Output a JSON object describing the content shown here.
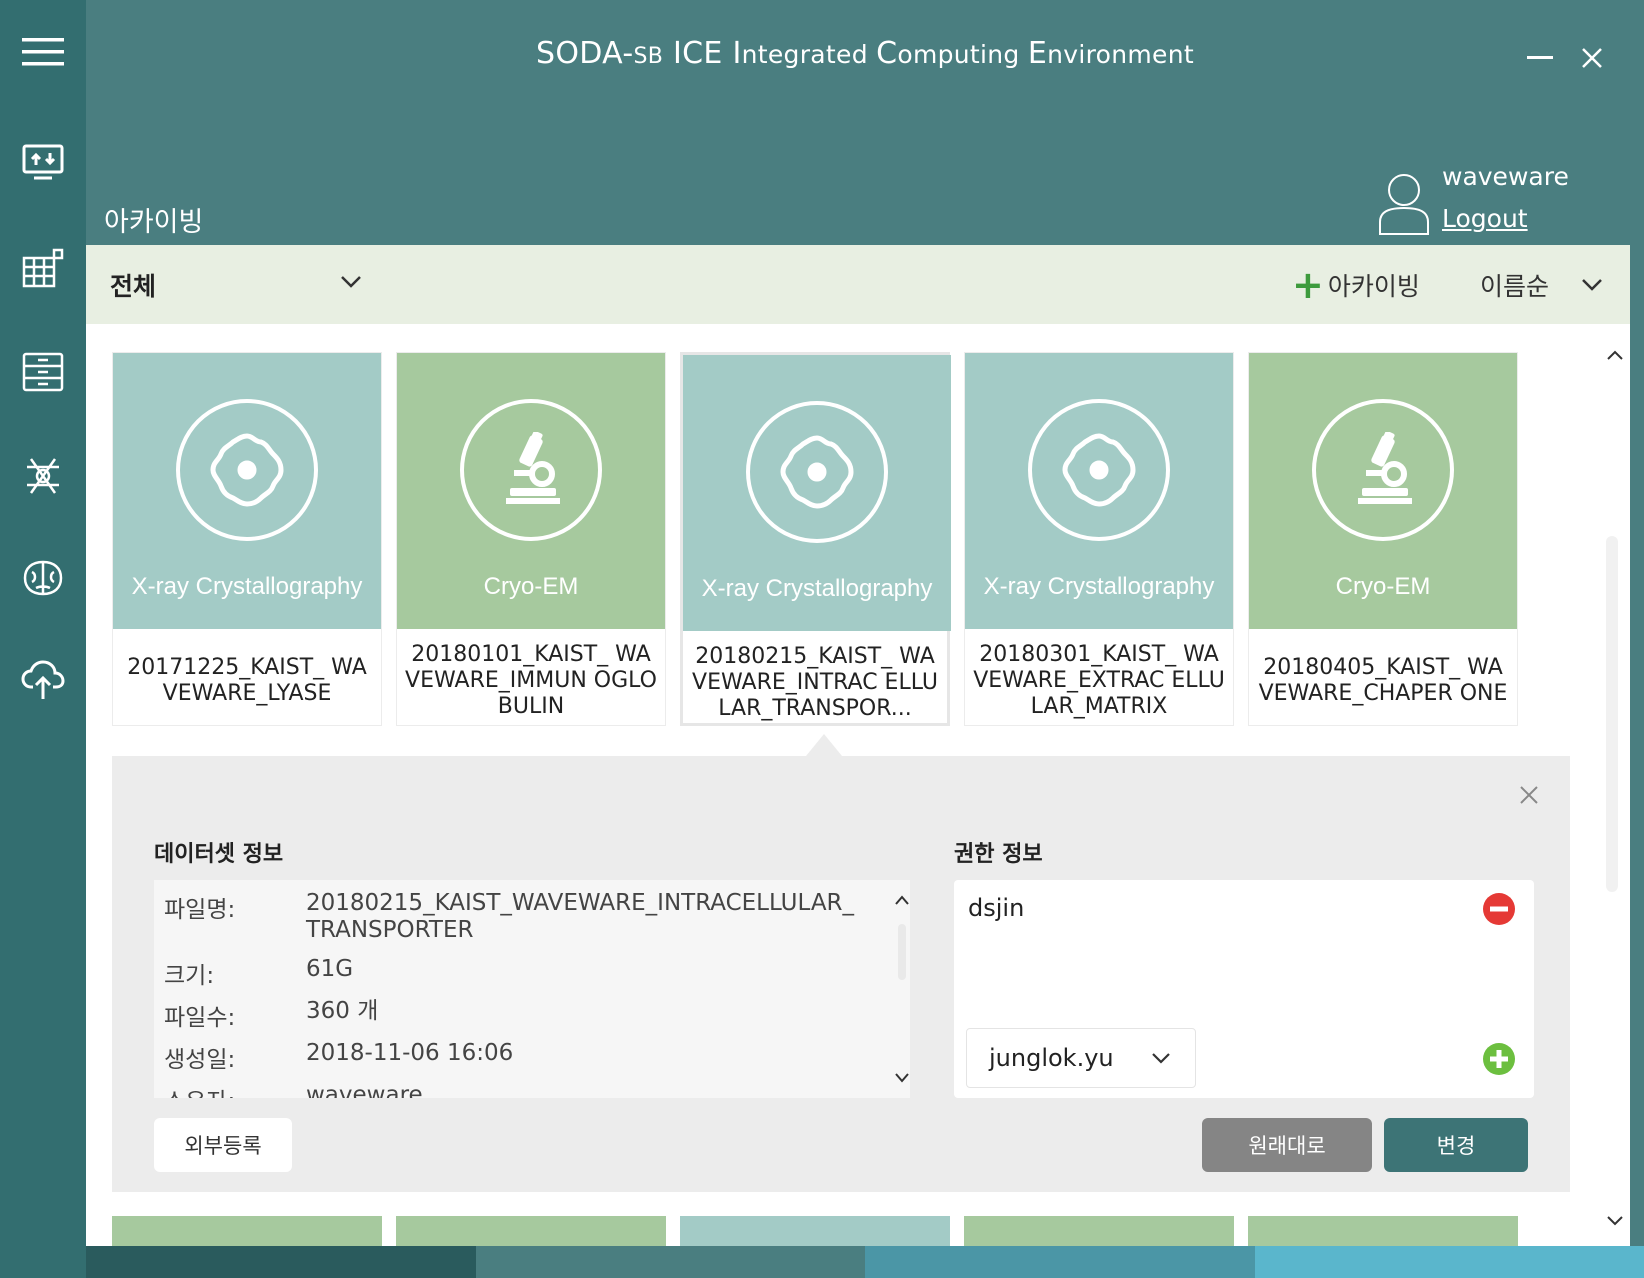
{
  "header": {
    "title_brand": "SODA-",
    "title_sb": "SB",
    "title_ice": " ICE",
    "title_i": " I",
    "title_ntegrated": "ntegrated ",
    "title_c": "C",
    "title_omputing": "omputing ",
    "title_e": "E",
    "title_nvironment": "nvironment",
    "section_title": "아카이빙",
    "username": "waveware",
    "logout_label": "Logout"
  },
  "rail": {
    "items": [
      "menu-icon",
      "monitor-transfer-icon",
      "table-icon",
      "server-icon",
      "molecule-icon",
      "brain-icon",
      "cloud-upload-icon"
    ]
  },
  "filter_bar": {
    "filter_label": "전체",
    "add_archive_label": "아카이빙",
    "sort_label": "이름순"
  },
  "cards": [
    {
      "category": "X-ray Crystallography",
      "name": "20171225_KAIST_ WAVEWARE_LYASE",
      "color": "teal",
      "icon": "crystal-icon"
    },
    {
      "category": "Cryo-EM",
      "name": "20180101_KAIST_ WAVEWARE_IMMUN OGLOBULIN",
      "color": "green",
      "icon": "microscope-icon"
    },
    {
      "category": "X-ray Crystallography",
      "name": "20180215_KAIST_ WAVEWARE_INTRAC ELLULAR_TRANSPOR...",
      "color": "teal",
      "icon": "crystal-icon"
    },
    {
      "category": "X-ray Crystallography",
      "name": "20180301_KAIST_ WAVEWARE_EXTRAC ELLULAR_MATRIX",
      "color": "teal",
      "icon": "crystal-icon"
    },
    {
      "category": "Cryo-EM",
      "name": "20180405_KAIST_ WAVEWARE_CHAPER ONE",
      "color": "green",
      "icon": "microscope-icon"
    }
  ],
  "detail": {
    "dataset_info_title": "데이터셋 정보",
    "permission_title": "권한 정보",
    "fields": [
      {
        "key": "파일명:",
        "value": "20180215_KAIST_WAVEWARE_INTRACELLULAR_TRANSPORTER"
      },
      {
        "key": "크기:",
        "value": "61G"
      },
      {
        "key": "파일수:",
        "value": "360 개"
      },
      {
        "key": "생성일:",
        "value": "2018-11-06 16:06"
      },
      {
        "key": "소유자:",
        "value": "waveware"
      }
    ],
    "permission_user": "dsjin",
    "user_select_value": "junglok.yu",
    "external_register_label": "외부등록",
    "reset_label": "원래대로",
    "apply_label": "변경"
  },
  "colors": {
    "rail": "#336e70",
    "header": "#4a7e80",
    "filter_bar": "#e8efe2",
    "teal_card": "#a3cbc6",
    "green_card": "#a6c99e",
    "bottom_bar": [
      "#2a5b5d",
      "#4a7e80",
      "#4b96a6",
      "#5ab6cc"
    ]
  }
}
